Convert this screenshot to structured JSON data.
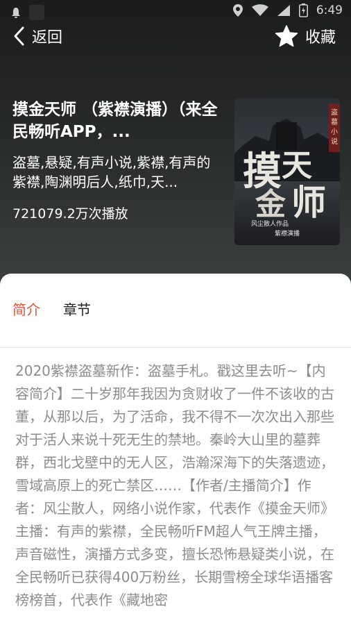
{
  "status_bar": {
    "time": "6:49",
    "icons": [
      "notification-icon",
      "app-icon",
      "location-icon",
      "wifi-icon",
      "signal-icon",
      "battery-icon"
    ]
  },
  "topbar": {
    "back_label": "返回",
    "favorite_label": "收藏"
  },
  "album": {
    "title": "摸金天师 （紫襟演播）（来全民畅听APP，...",
    "tags": "盗墓,悬疑,有声小说,紫襟,有声的紫襟,陶渊明后人,纸巾,天...",
    "plays": "721079.2万次播放",
    "cover": {
      "main_text": "摸金天师",
      "subtitle": "风尘散人作品",
      "narrator": "紫襟演播",
      "side_text": "盗墓小说"
    }
  },
  "tabs": [
    {
      "label": "简介",
      "active": true
    },
    {
      "label": "章节",
      "active": false
    }
  ],
  "description": "2020紫襟盗墓新作：盗墓手札。戳这里去听~【内容简介】二十岁那年我因为贪财收了一件不该收的古董，从那以后，为了活命，我不得不一次次出入那些对于活人来说十死无生的禁地。秦岭大山里的墓葬群，西北戈壁中的无人区，浩瀚深海下的失落遗迹，雪域高原上的死亡禁区……【作者/主播简介】作者：风尘散人，网络小说作家，代表作《摸金天师》主播：有声的紫襟，全民畅听FM超人气王牌主播，声音磁性，演播方式多变，擅长恐怖悬疑类小说，在全民畅听已获得400万粉丝，长期雪榜全球华语播客榜榜首，代表作《藏地密",
  "colors": {
    "accent": "#e0533b",
    "hero_bg": "#262a28"
  }
}
